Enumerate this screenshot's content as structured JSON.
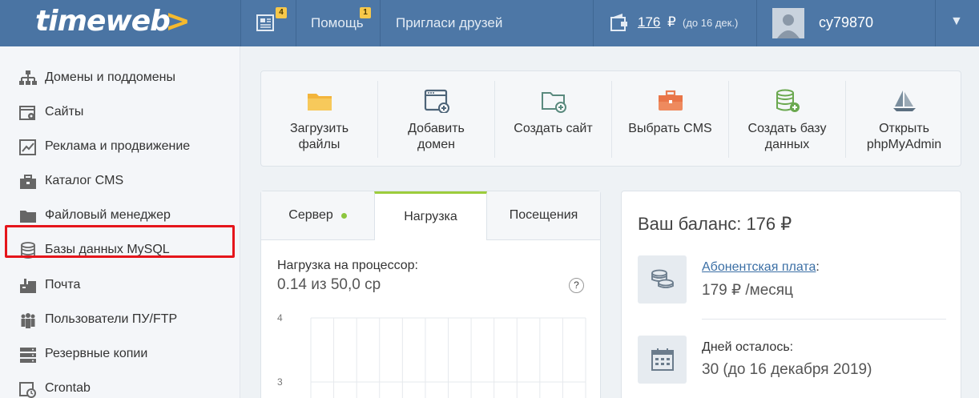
{
  "header": {
    "logo": "timeweb",
    "logo_arrow": ">",
    "news_badge": "4",
    "help_label": "Помощь",
    "help_badge": "1",
    "invite_label": "Пригласи друзей",
    "balance_value": "176",
    "balance_currency": "₽",
    "balance_note": "(до 16 дек.)",
    "username": "cy79870",
    "caret": "▼"
  },
  "sidebar": {
    "items": [
      {
        "label": "Домены и поддомены",
        "icon": "sitemap-icon"
      },
      {
        "label": "Сайты",
        "icon": "window-gear-icon"
      },
      {
        "label": "Реклама и продвижение",
        "icon": "chart-line-icon"
      },
      {
        "label": "Каталог CMS",
        "icon": "briefcase-icon"
      },
      {
        "label": "Файловый менеджер",
        "icon": "folder-icon"
      },
      {
        "label": "Базы данных MySQL",
        "icon": "database-icon"
      },
      {
        "label": "Почта",
        "icon": "mailbox-icon"
      },
      {
        "label": "Пользователи ПУ/FTP",
        "icon": "users-icon"
      },
      {
        "label": "Резервные копии",
        "icon": "server-icon"
      },
      {
        "label": "Crontab",
        "icon": "clock-icon"
      }
    ],
    "highlighted": "Почта",
    "highlight_color": "#e5151b"
  },
  "quick_actions": [
    {
      "label": "Загрузить\nфайлы",
      "icon": "folder-icon"
    },
    {
      "label": "Добавить\nдомен",
      "icon": "add-domain-icon"
    },
    {
      "label": "Создать сайт",
      "icon": "folder-plus-icon"
    },
    {
      "label": "Выбрать CMS",
      "icon": "briefcase-icon"
    },
    {
      "label": "Создать базу\nданных",
      "icon": "database-plus-icon"
    },
    {
      "label": "Открыть\nphpMyAdmin",
      "icon": "sailboat-icon"
    }
  ],
  "load_card": {
    "tabs": [
      {
        "label": "Сервер",
        "status_dot": true
      },
      {
        "label": "Нагрузка",
        "active": true
      },
      {
        "label": "Посещения"
      }
    ],
    "cpu_label": "Нагрузка на процессор:",
    "cpu_value": "0.14 из 50,0 ср",
    "help": "?"
  },
  "chart_data": {
    "type": "line",
    "title": "",
    "xlabel": "",
    "ylabel": "",
    "y_ticks": [
      "4",
      "3"
    ],
    "ylim": [
      2.6,
      4
    ],
    "grid": true,
    "series": []
  },
  "balance_card": {
    "title": "Ваш баланс: 176 ₽",
    "fee_link": "Абонентская плата",
    "fee_colon": ":",
    "fee_value": "179 ₽ /месяц",
    "days_label": "Дней осталось:",
    "days_value": "30 (до 16 декабря 2019)"
  },
  "colors": {
    "header_bg": "#4d77a6",
    "accent_green": "#9ccc3c",
    "link": "#3b6fa5",
    "logo_arrow": "#f5b92d"
  }
}
